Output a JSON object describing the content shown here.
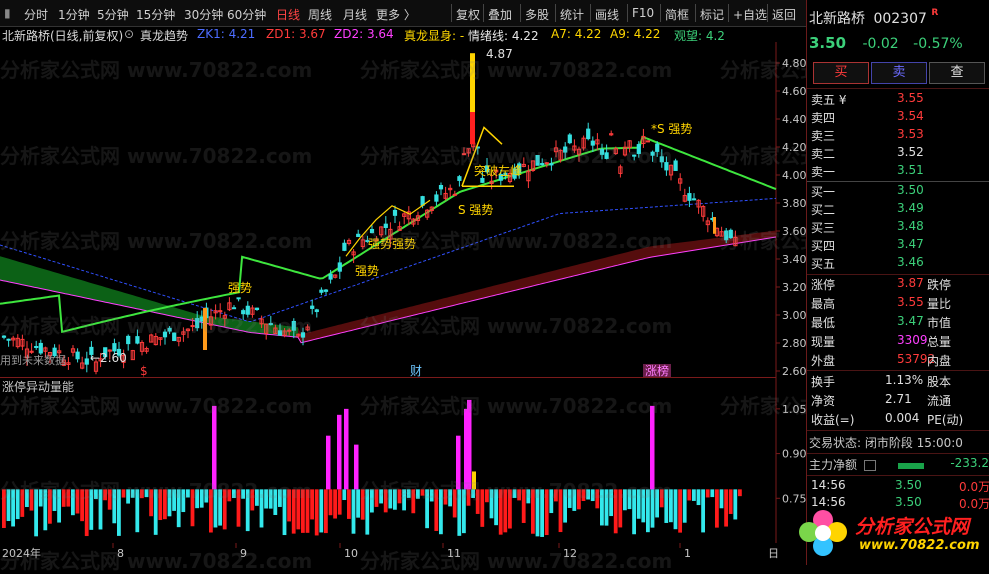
{
  "toolbar": {
    "left_items": [
      "分时",
      "1分钟",
      "5分钟",
      "15分钟",
      "30分钟",
      "60分钟",
      "日线",
      "周线",
      "月线",
      "更多 〉"
    ],
    "active_item": "日线",
    "right_items": [
      "复权",
      "叠加",
      "多股",
      "统计",
      "画线",
      "F10",
      "简框",
      "标记",
      "+自选",
      "返回"
    ]
  },
  "indicator_line": {
    "title": "北新路桥(日线,前复权)",
    "name": "真龙趋势",
    "zk1": "ZK1: 4.21",
    "zd1": "ZD1: 3.67",
    "zd2": "ZD2: 3.64",
    "zlx": "真龙显身: -",
    "qxx": "情绪线: 4.22",
    "a7": "A7: 4.22",
    "a9": "A9: 4.22",
    "gw": "观望: 4.2"
  },
  "main_chart": {
    "y_ticks": [
      "4.80",
      "4.60",
      "4.40",
      "4.20",
      "4.00",
      "3.80",
      "3.60",
      "3.40",
      "3.20",
      "3.00",
      "2.80",
      "2.60"
    ],
    "high_label": "4.87",
    "low_label": "←2.60",
    "notes": [
      "用到未来数据"
    ],
    "annotations": {
      "strong": [
        "强势",
        "强势",
        "强势",
        "强势",
        "S 强势",
        "*S 强势"
      ],
      "breakout": "突破左峰"
    },
    "event_markers": [
      "$",
      "财",
      "涨榜"
    ]
  },
  "sub_chart": {
    "title": "涨停异动量能",
    "y_ticks": [
      "1.05",
      "0.90",
      "0.75"
    ]
  },
  "x_axis": [
    "2024年",
    "8",
    "9",
    "10",
    "11",
    "12",
    "1",
    "日"
  ],
  "chart_data": {
    "type": "candlestick",
    "ylim": [
      2.55,
      4.95
    ],
    "price_range": {
      "low": 2.6,
      "high": 4.87,
      "last": 3.5
    },
    "sub_ylim": [
      0.6,
      1.12
    ]
  },
  "quote": {
    "stock_name": "北新路桥",
    "stock_code": "002307",
    "tag": "R",
    "price": "3.50",
    "change": "-0.02",
    "change_pct": "-0.57%",
    "buttons": {
      "buy": "买",
      "sell": "卖",
      "query": "查"
    },
    "asks": [
      {
        "label": "卖五 ¥",
        "price": "3.55"
      },
      {
        "label": "卖四",
        "price": "3.54"
      },
      {
        "label": "卖三",
        "price": "3.53"
      },
      {
        "label": "卖二",
        "price": "3.52"
      },
      {
        "label": "卖一",
        "price": "3.51"
      }
    ],
    "bids": [
      {
        "label": "买一",
        "price": "3.50"
      },
      {
        "label": "买二",
        "price": "3.49"
      },
      {
        "label": "买三",
        "price": "3.48"
      },
      {
        "label": "买四",
        "price": "3.47"
      },
      {
        "label": "买五",
        "price": "3.46"
      }
    ],
    "stats": [
      {
        "label": "涨停",
        "value": "3.87",
        "label2": "跌停"
      },
      {
        "label": "最高",
        "value": "3.55",
        "label2": "量比"
      },
      {
        "label": "最低",
        "value": "3.47",
        "label2": "市值"
      },
      {
        "label": "现量",
        "value": "3309",
        "label2": "总量"
      },
      {
        "label": "外盘",
        "value": "53792",
        "label2": "内盘"
      }
    ],
    "fin": [
      {
        "label": "换手",
        "value": "1.13%",
        "label2": "股本"
      },
      {
        "label": "净资",
        "value": "2.71",
        "label2": "流通"
      },
      {
        "label": "收益(=)",
        "value": "0.004",
        "label2": "PE(动)"
      }
    ],
    "trade_state": "交易状态: 闭市阶段 15:00:0",
    "net_flow_label": "主力净额",
    "net_flow_value": "-233.2",
    "ticks": [
      {
        "time": "14:56",
        "price": "3.50",
        "vol": "0.0万"
      },
      {
        "time": "14:56",
        "price": "3.50",
        "vol": "0.0万"
      }
    ]
  },
  "watermark": {
    "text": "分析家公式网 www.70822.com",
    "logo_text": "分析家公式网",
    "logo_url": "www.70822.com"
  }
}
